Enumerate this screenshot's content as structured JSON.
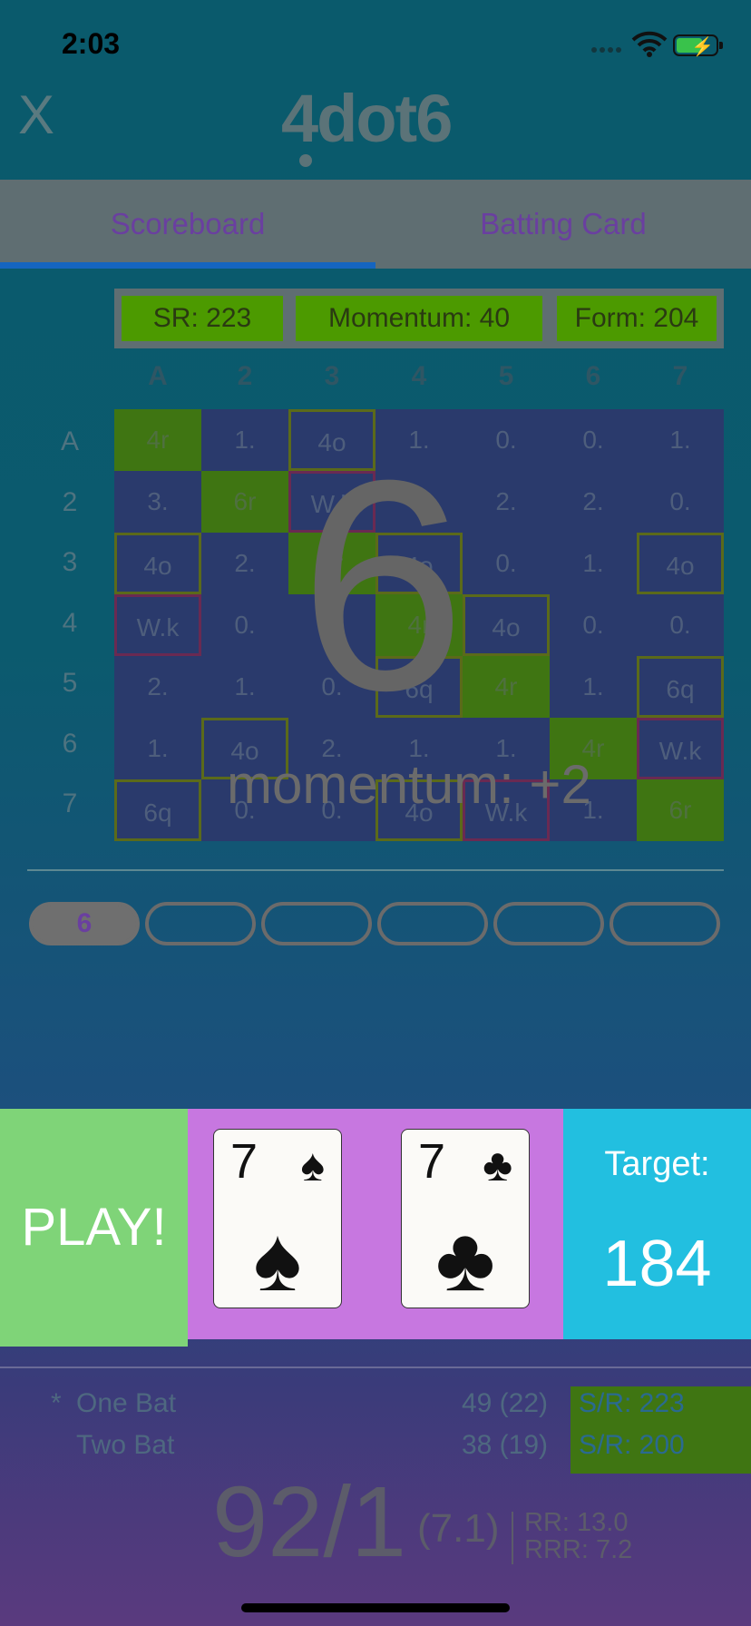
{
  "status_bar": {
    "time": "2:03"
  },
  "header": {
    "close_label": "X",
    "logo_text": "4dot6"
  },
  "tabs": [
    {
      "label": "Scoreboard",
      "active": true
    },
    {
      "label": "Batting Card",
      "active": false
    }
  ],
  "stats": {
    "sr": "SR: 223",
    "momentum": "Momentum: 40",
    "form": "Form: 204"
  },
  "grid": {
    "col_headers": [
      "A",
      "2",
      "3",
      "4",
      "5",
      "6",
      "7"
    ],
    "row_headers": [
      "A",
      "2",
      "3",
      "4",
      "5",
      "6",
      "7"
    ],
    "cells": [
      [
        {
          "v": "4r",
          "s": "g"
        },
        {
          "v": "1.",
          "s": ""
        },
        {
          "v": "4o",
          "s": "y"
        },
        {
          "v": "1.",
          "s": ""
        },
        {
          "v": "0.",
          "s": ""
        },
        {
          "v": "0.",
          "s": ""
        },
        {
          "v": "1.",
          "s": ""
        }
      ],
      [
        {
          "v": "3.",
          "s": ""
        },
        {
          "v": "6r",
          "s": "g"
        },
        {
          "v": "W.k",
          "s": "r"
        },
        {
          "v": "0.",
          "s": ""
        },
        {
          "v": "2.",
          "s": ""
        },
        {
          "v": "2.",
          "s": ""
        },
        {
          "v": "0.",
          "s": ""
        }
      ],
      [
        {
          "v": "4o",
          "s": "y"
        },
        {
          "v": "2.",
          "s": ""
        },
        {
          "v": "6r",
          "s": "g"
        },
        {
          "v": "4o",
          "s": "y"
        },
        {
          "v": "0.",
          "s": ""
        },
        {
          "v": "1.",
          "s": ""
        },
        {
          "v": "4o",
          "s": "y"
        }
      ],
      [
        {
          "v": "W.k",
          "s": "r"
        },
        {
          "v": "0.",
          "s": ""
        },
        {
          "v": "1.",
          "s": ""
        },
        {
          "v": "4r",
          "s": "g"
        },
        {
          "v": "4o",
          "s": "y"
        },
        {
          "v": "0.",
          "s": ""
        },
        {
          "v": "0.",
          "s": ""
        }
      ],
      [
        {
          "v": "2.",
          "s": ""
        },
        {
          "v": "1.",
          "s": ""
        },
        {
          "v": "0.",
          "s": ""
        },
        {
          "v": "6q",
          "s": "y"
        },
        {
          "v": "4r",
          "s": "g"
        },
        {
          "v": "1.",
          "s": ""
        },
        {
          "v": "6q",
          "s": "y"
        }
      ],
      [
        {
          "v": "1.",
          "s": ""
        },
        {
          "v": "4o",
          "s": "y"
        },
        {
          "v": "2.",
          "s": ""
        },
        {
          "v": "1.",
          "s": ""
        },
        {
          "v": "1.",
          "s": ""
        },
        {
          "v": "4r",
          "s": "g"
        },
        {
          "v": "W.k",
          "s": "r"
        }
      ],
      [
        {
          "v": "6q",
          "s": "y"
        },
        {
          "v": "0.",
          "s": ""
        },
        {
          "v": "0.",
          "s": ""
        },
        {
          "v": "4o",
          "s": "y"
        },
        {
          "v": "W.k",
          "s": "r"
        },
        {
          "v": "1.",
          "s": ""
        },
        {
          "v": "6r",
          "s": "g"
        }
      ]
    ]
  },
  "overlay": {
    "result": "6",
    "momentum": "momentum: +2"
  },
  "balls": [
    "6",
    "",
    "",
    "",
    "",
    ""
  ],
  "play": {
    "label": "PLAY!"
  },
  "cards": [
    {
      "rank": "7",
      "suit": "♠"
    },
    {
      "rank": "7",
      "suit": "♣"
    }
  ],
  "target": {
    "label": "Target:",
    "value": "184"
  },
  "batsmen": [
    {
      "marker": "*",
      "name": "One Bat",
      "runs": "49 (22)",
      "sr": "S/R: 223"
    },
    {
      "marker": "",
      "name": "Two Bat",
      "runs": "38 (19)",
      "sr": "S/R: 200"
    }
  ],
  "score": {
    "total": "92/1",
    "overs": "(7.1)",
    "rr": "RR: 13.0",
    "rrr": "RRR: 7.2"
  },
  "colors": {
    "grid_green": "#3f7512",
    "play_green": "#7fd478",
    "cards_purple": "#c777e0",
    "target_blue": "#22bfe0",
    "tab_indicator": "#1565c0"
  }
}
